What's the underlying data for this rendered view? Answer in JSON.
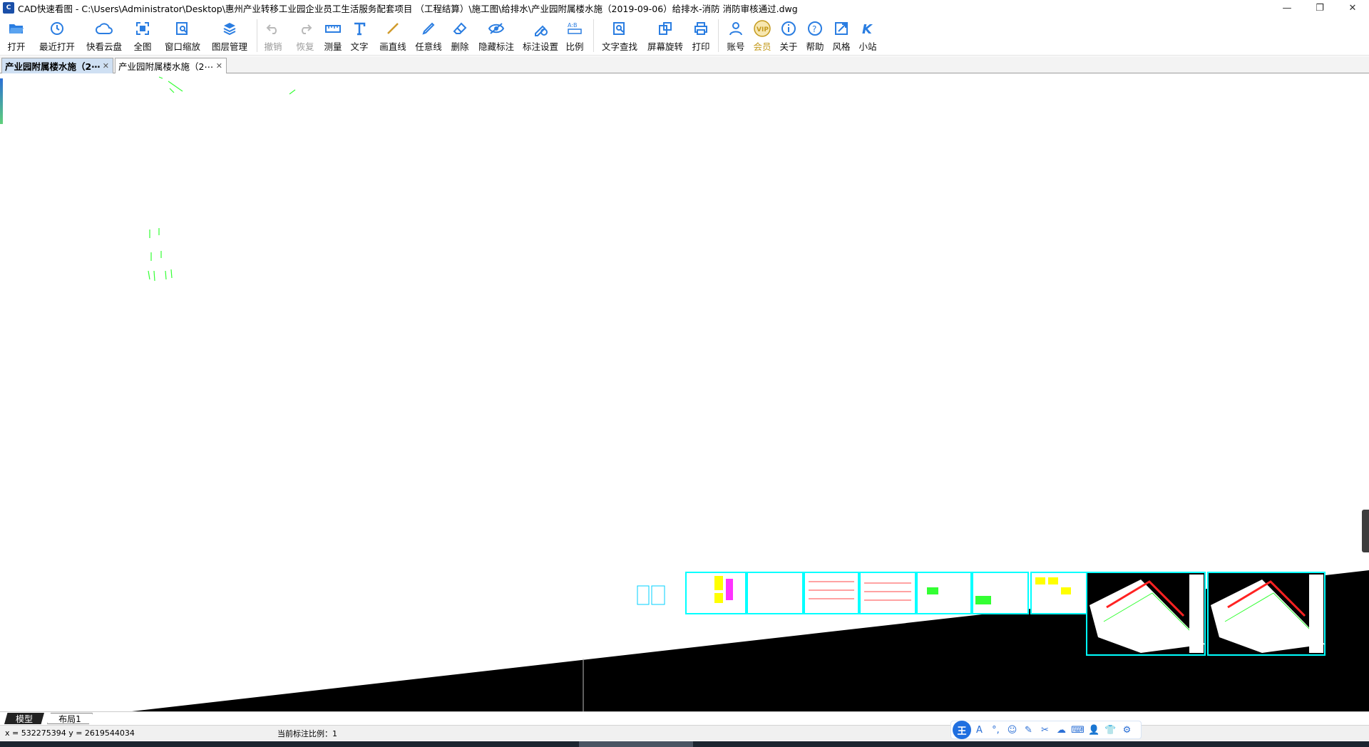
{
  "window": {
    "title": "CAD快速看图 - C:\\Users\\Administrator\\Desktop\\惠州产业转移工业园企业员工生活服务配套项目 （工程结算）\\施工图\\给排水\\产业园附属楼水施（2019-09-06）给排水-消防 消防审核通过.dwg",
    "app_icon": "cad-app-icon",
    "controls": [
      "minimize",
      "restore",
      "close"
    ]
  },
  "toolbar": {
    "items": [
      {
        "label": "打开",
        "icon": "folder-open-icon"
      },
      {
        "label": "最近打开",
        "icon": "recent-icon"
      },
      {
        "label": "快看云盘",
        "icon": "cloud-icon"
      },
      {
        "label": "全图",
        "icon": "fit-view-icon"
      },
      {
        "label": "窗口缩放",
        "icon": "zoom-window-icon"
      },
      {
        "label": "图层管理",
        "icon": "layers-icon"
      },
      {
        "label": "撤销",
        "icon": "undo-icon",
        "disabled": true
      },
      {
        "label": "恢复",
        "icon": "redo-icon",
        "disabled": true
      },
      {
        "label": "测量",
        "icon": "measure-icon"
      },
      {
        "label": "文字",
        "icon": "text-icon"
      },
      {
        "label": "画直线",
        "icon": "line-icon"
      },
      {
        "label": "任意线",
        "icon": "freehand-icon"
      },
      {
        "label": "删除",
        "icon": "eraser-icon"
      },
      {
        "label": "隐藏标注",
        "icon": "hide-eye-icon"
      },
      {
        "label": "标注设置",
        "icon": "annotation-settings-icon"
      },
      {
        "label": "比例",
        "icon": "scale-icon"
      },
      {
        "label": "文字查找",
        "icon": "text-search-icon"
      },
      {
        "label": "屏幕旋转",
        "icon": "rotate-screen-icon"
      },
      {
        "label": "打印",
        "icon": "print-icon"
      },
      {
        "label": "账号",
        "icon": "account-icon"
      },
      {
        "label": "会员",
        "icon": "vip-icon"
      },
      {
        "label": "关于",
        "icon": "info-icon"
      },
      {
        "label": "帮助",
        "icon": "help-icon"
      },
      {
        "label": "风格",
        "icon": "style-icon"
      },
      {
        "label": "小站",
        "icon": "site-icon"
      }
    ]
  },
  "tabs": [
    {
      "label": "产业园附属楼水施（2⋯",
      "active": true
    },
    {
      "label": "产业园附属楼水施（2⋯",
      "active": false
    }
  ],
  "layout_tabs": {
    "model": "模型",
    "layout1": "布局1"
  },
  "status": {
    "coords": "x = 532275394  y = 2619544034",
    "scale": "当前标注比例：1"
  },
  "ime": {
    "main": "王",
    "icons": [
      "A",
      "°,",
      "☺",
      "✎",
      "✂",
      "☁",
      "⌨",
      "👤",
      "👕",
      "⚙"
    ]
  },
  "colors": {
    "accent": "#1f6fe0",
    "cad_green": "#33ff33",
    "cad_cyan": "#00ffff",
    "vip": "#c49a1c"
  }
}
